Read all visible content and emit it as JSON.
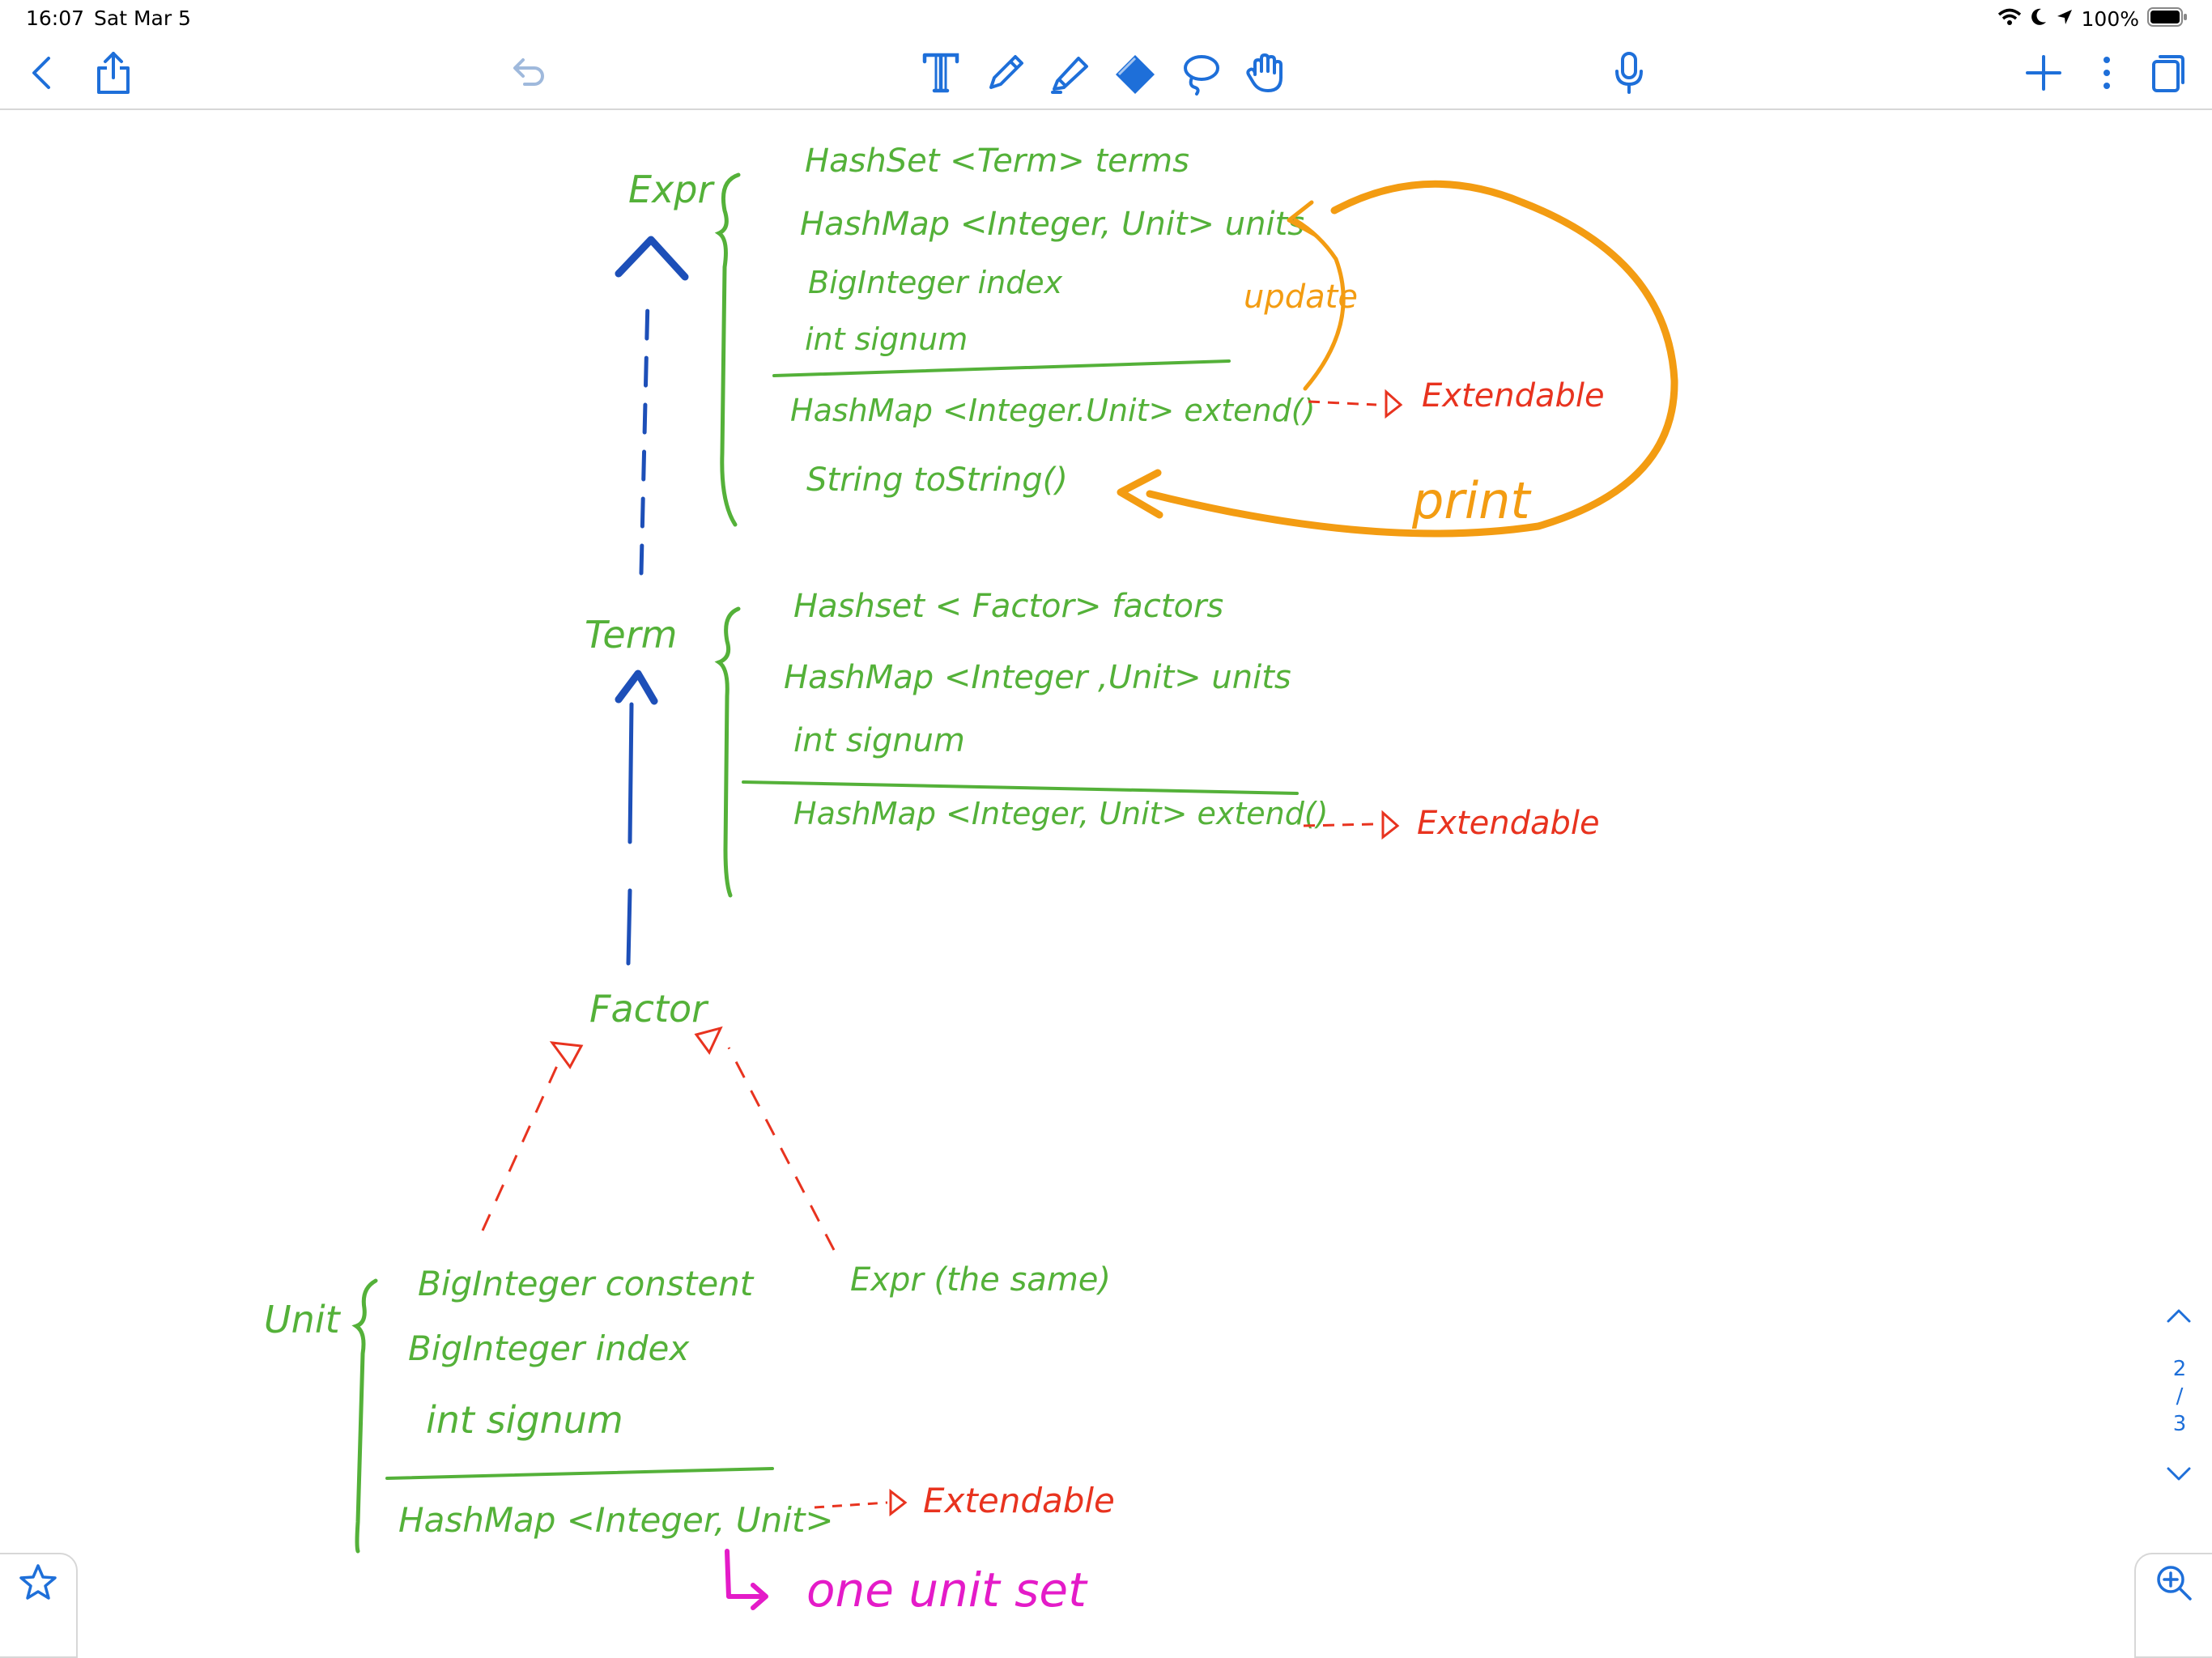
{
  "status_bar": {
    "time": "16:07",
    "date": "Sat Mar 5",
    "battery_text": "100%"
  },
  "toolbar": {
    "left": [
      "back-icon",
      "share-icon"
    ],
    "undo": "undo-icon",
    "tools": [
      "text-tool-icon",
      "pen-tool-icon",
      "highlighter-tool-icon",
      "eraser-tool-icon",
      "lasso-tool-icon",
      "hand-tool-icon"
    ],
    "mic": "microphone-icon",
    "right": [
      "add-icon",
      "more-icon",
      "pages-icon"
    ]
  },
  "colors": {
    "green_ink": "#54b139",
    "red_ink": "#e8331f",
    "orange_ink": "#f39c12",
    "magenta_ink": "#e41bc8",
    "blue_ink": "#1d4fb8",
    "accent": "#1e6fd9"
  },
  "note": {
    "expr": {
      "title": "Expr",
      "fields": [
        "HashSet <Term> terms",
        "HashMap <Integer, Unit> units",
        "BigInteger index",
        "int signum"
      ],
      "methods": [
        "HashMap <Integer.Unit> extend()",
        "String toString()"
      ],
      "extend_note": "Extendable"
    },
    "annotations": {
      "update": "update",
      "print": "print"
    },
    "term": {
      "title": "Term",
      "fields": [
        "Hashset < Factor> factors",
        "HashMap <Integer ,Unit> units",
        "int signum"
      ],
      "methods": [
        "HashMap <Integer, Unit> extend()"
      ],
      "extend_note": "Extendable"
    },
    "factor": {
      "title": "Factor"
    },
    "expr_same": "Expr (the same)",
    "unit": {
      "title": "Unit",
      "fields": [
        "BigInteger constent",
        "BigInteger index",
        "int signum"
      ],
      "methods": [
        "HashMap <Integer, Unit>"
      ],
      "extend_note": "Extendable",
      "footnote": "one unit set"
    }
  },
  "pager": {
    "current": "2",
    "separator": "/",
    "total": "3"
  }
}
